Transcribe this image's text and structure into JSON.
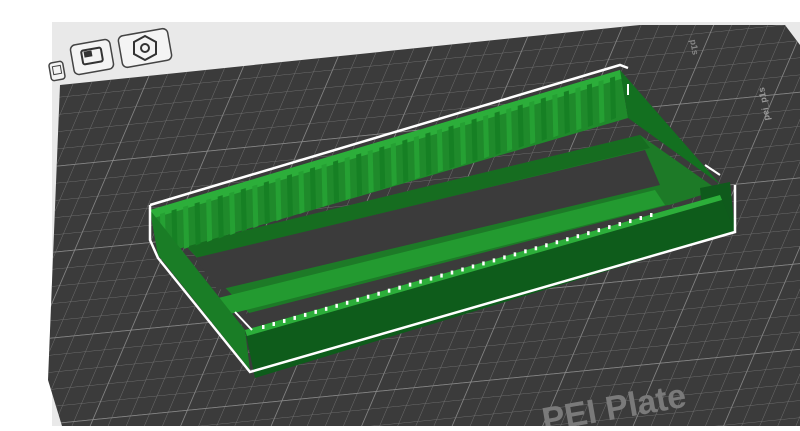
{
  "app": {
    "view": "3D slicer build plate preview"
  },
  "toolbar": {
    "buttons": [
      {
        "name": "add-plate-button",
        "icon": "plate-icon"
      },
      {
        "name": "orient-button",
        "icon": "layout-icon"
      },
      {
        "name": "settings-button",
        "icon": "gear-icon"
      }
    ]
  },
  "plate": {
    "label": "PEI Plate",
    "label_visible": "PEI Plate",
    "side_text_right": "pei_p1s",
    "side_text_top": "p1s"
  },
  "model": {
    "name": "slotted tray",
    "color": "#1f8a2b",
    "dark_color": "#0f5a1c",
    "selection_outline": "#ffffff"
  },
  "colors": {
    "plate_bg": "#3a3a3a",
    "grid_line": "#6e6e6e",
    "outside_bg": "#ffffff",
    "plate_border": "#e6e6e6"
  }
}
